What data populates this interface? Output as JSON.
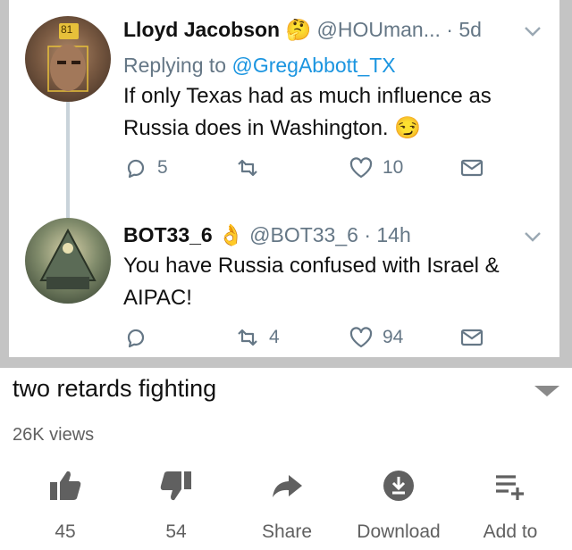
{
  "tweets": [
    {
      "name": "Lloyd Jacobson",
      "name_emoji": "🤔",
      "handle": "@HOUman...",
      "time": "· 5d",
      "replying_prefix": "Replying to",
      "replying_to": "@GregAbbott_TX",
      "text_line1": "If only Texas had as much influence as",
      "text_line2": "Russia does in Washington. 😏",
      "reply_count": "5",
      "retweet_count": "",
      "like_count": "10"
    },
    {
      "name": "BOT33_6",
      "name_emoji": "👌",
      "handle": "@BOT33_6 · 14h",
      "text_line1": "You have Russia confused with Israel &",
      "text_line2": "AIPAC!",
      "reply_count": "",
      "retweet_count": "4",
      "like_count": "94"
    }
  ],
  "avatar1_badge": "81",
  "video": {
    "title": "two retards fighting",
    "views": "26K views",
    "actions": [
      {
        "label": "45",
        "icon": "thumbs-up-icon"
      },
      {
        "label": "54",
        "icon": "thumbs-down-icon"
      },
      {
        "label": "Share",
        "icon": "share-icon"
      },
      {
        "label": "Download",
        "icon": "download-icon"
      },
      {
        "label": "Add to",
        "icon": "add-to-playlist-icon"
      }
    ]
  },
  "colors": {
    "link": "#1b95e0",
    "muted": "#657786",
    "frame": "#c4c4c4"
  }
}
